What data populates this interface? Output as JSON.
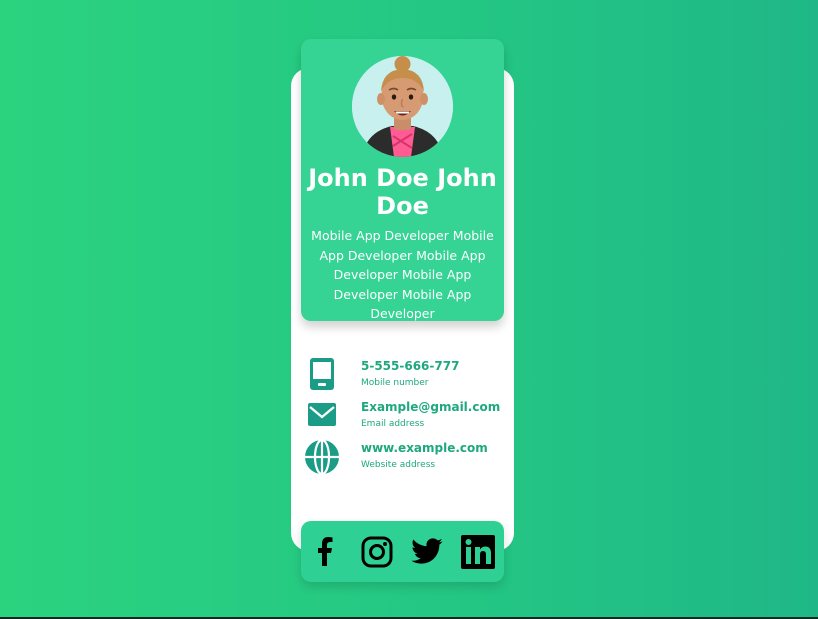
{
  "profile": {
    "name": "John Doe John Doe",
    "role": "Mobile App Developer Mobile App Developer Mobile App Developer Mobile App Developer Mobile App Developer"
  },
  "contacts": [
    {
      "icon": "tablet-icon",
      "value": "5-555-666-777",
      "label": "Mobile number"
    },
    {
      "icon": "mail-icon",
      "value": "Example@gmail.com",
      "label": "Email address"
    },
    {
      "icon": "globe-icon",
      "value": "www.example.com",
      "label": "Website address"
    }
  ],
  "social": [
    {
      "icon": "facebook-icon"
    },
    {
      "icon": "instagram-icon"
    },
    {
      "icon": "twitter-icon"
    },
    {
      "icon": "linkedin-icon"
    }
  ],
  "colors": {
    "background_start": "#2bd37f",
    "background_end": "#1fb787",
    "panel": "#35d394",
    "contact_text": "#1da87e",
    "contact_icon": "#1a9c86",
    "card": "#ffffff"
  }
}
